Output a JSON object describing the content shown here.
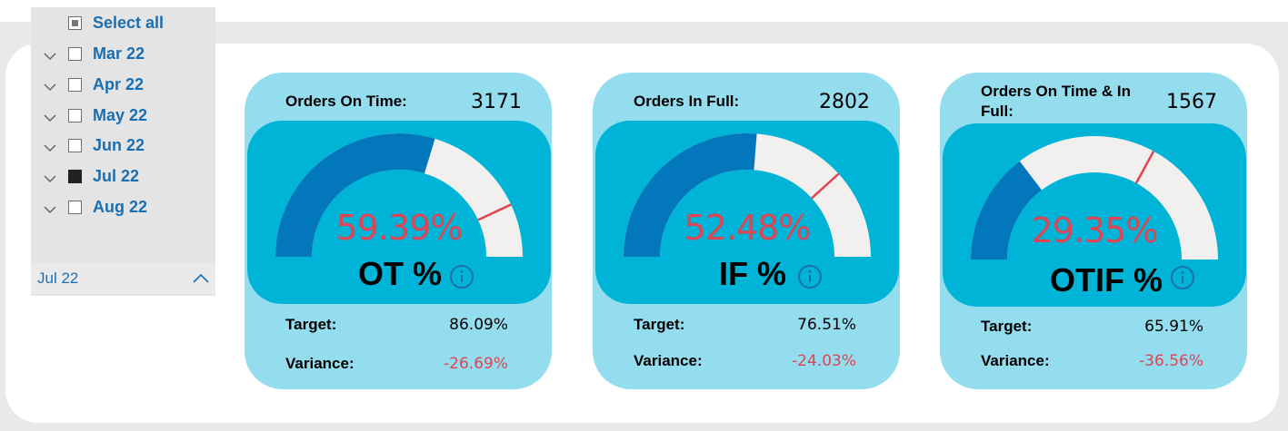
{
  "slicer": {
    "select_all": "Select all",
    "items": [
      {
        "label": "Mar 22",
        "checked": false
      },
      {
        "label": "Apr 22",
        "checked": false
      },
      {
        "label": "May 22",
        "checked": false
      },
      {
        "label": "Jun 22",
        "checked": false
      },
      {
        "label": "Jul 22",
        "checked": true
      },
      {
        "label": "Aug 22",
        "checked": false
      }
    ],
    "selected_value": "Jul 22"
  },
  "cards": [
    {
      "metric_label": "Orders On Time:",
      "metric_value": "3171",
      "gauge_value": "59.39%",
      "gauge_fraction": 0.5939,
      "target_fraction": 0.8609,
      "gauge_name": "OT %",
      "target_label": "Target:",
      "target_value": "86.09%",
      "variance_label": "Variance:",
      "variance_value": "-26.69%"
    },
    {
      "metric_label": "Orders In Full:",
      "metric_value": "2802",
      "gauge_value": "52.48%",
      "gauge_fraction": 0.5248,
      "target_fraction": 0.7651,
      "gauge_name": "IF %",
      "target_label": "Target:",
      "target_value": "76.51%",
      "variance_label": "Variance:",
      "variance_value": "-24.03%"
    },
    {
      "metric_label": "Orders On Time & In Full:",
      "metric_value": "1567",
      "gauge_value": "29.35%",
      "gauge_fraction": 0.2935,
      "target_fraction": 0.6591,
      "gauge_name": "OTIF %",
      "target_label": "Target:",
      "target_value": "65.91%",
      "variance_label": "Variance:",
      "variance_value": "-36.56%"
    }
  ],
  "colors": {
    "filled": "#0277bb",
    "remaining": "#f1f0ef",
    "target_line": "#e04452",
    "card_bg": "#93ddef",
    "gauge_bg": "#00b4d7",
    "negative": "#e04452"
  }
}
